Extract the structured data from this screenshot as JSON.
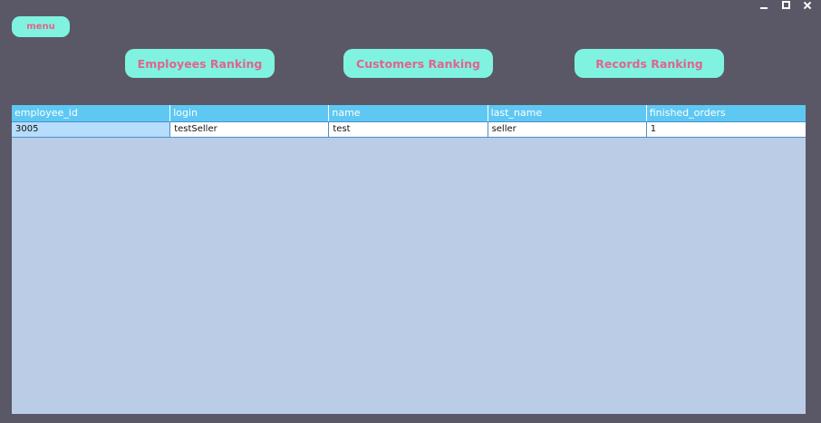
{
  "window_controls": {
    "minimize_icon": "minimize-icon",
    "maximize_icon": "maximize-icon",
    "close_icon": "close-icon"
  },
  "menu": {
    "label": "menu"
  },
  "nav": {
    "employees_ranking": "Employees Ranking",
    "customers_ranking": "Customers Ranking",
    "records_ranking": "Records Ranking"
  },
  "table": {
    "columns": [
      "employee_id",
      "login",
      "name",
      "last_name",
      "finished_orders"
    ],
    "rows": [
      [
        "3005",
        "testSeller",
        "test",
        "seller",
        "1"
      ]
    ]
  },
  "colors": {
    "background": "#5a5866",
    "button_bg": "#7ff3e0",
    "button_text": "#e0648f",
    "table_header": "#5ec8f3",
    "table_body": "#bbcde6",
    "selected_cell": "#b6ddfb"
  }
}
